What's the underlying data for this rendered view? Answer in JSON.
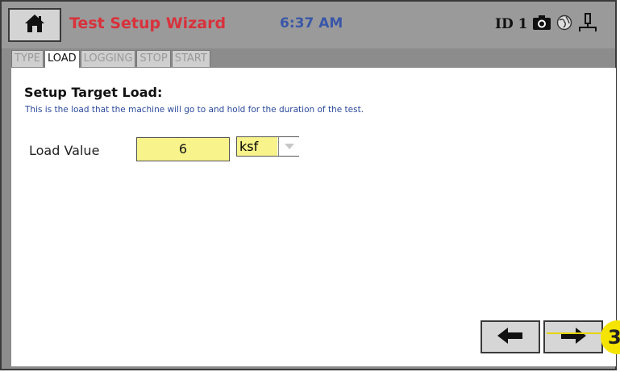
{
  "header": {
    "title": "Test Setup Wizard",
    "time": "6:37 AM",
    "device_id": "ID 1",
    "icons": [
      "home-icon",
      "camera-icon",
      "network-globe-icon",
      "usb-device-icon"
    ]
  },
  "tabs": [
    {
      "label": "TYPE",
      "active": false
    },
    {
      "label": "LOAD",
      "active": true
    },
    {
      "label": "LOGGING",
      "active": false
    },
    {
      "label": "STOP",
      "active": false
    },
    {
      "label": "START",
      "active": false
    }
  ],
  "main": {
    "section_title": "Setup Target Load:",
    "section_desc": "This is the load that the machine will go to and hold for the duration of the test.",
    "load_label": "Load Value",
    "load_value": "6",
    "unit_value": "ksf"
  },
  "callout": {
    "number": "3"
  },
  "colors": {
    "title_red": "#d8323c",
    "time_blue": "#3a57a8",
    "input_yellow": "#f8f38a",
    "callout_yellow": "#f5e400"
  }
}
